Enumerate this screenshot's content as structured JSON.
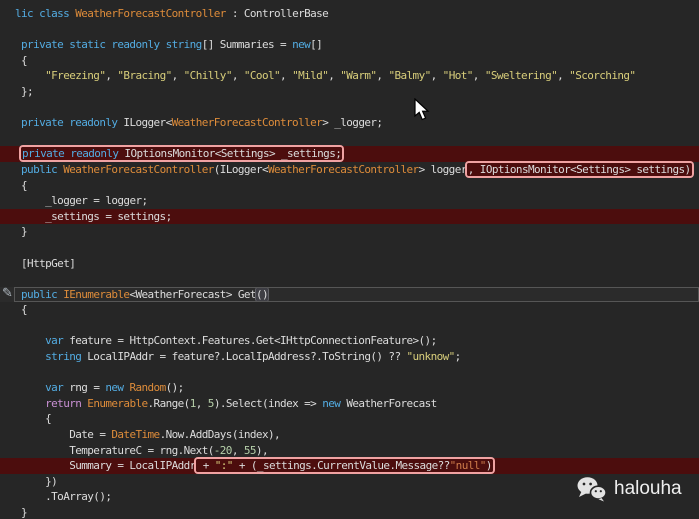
{
  "editor": {
    "language": "csharp",
    "colors": {
      "background": "#262626",
      "keyword": "#53ACE2",
      "type": "#DE8C3A",
      "string": "#D8CE7B",
      "number": "#B5CEA8",
      "control_keyword": "#C990D4",
      "string_alt": "#CE7B4A",
      "plain_text": "#DCDCDC",
      "changed_line_background": "#4C0D0D",
      "change_box_border": "#F0A2A2",
      "current_line_border": "#565656"
    },
    "lines": [
      {
        "indent": 0,
        "tokens": [
          [
            "lic class ",
            "k"
          ],
          [
            "WeatherForecastController",
            "t"
          ],
          [
            " : ",
            "p"
          ],
          [
            "ControllerBase",
            "p"
          ]
        ]
      },
      {
        "indent": 0,
        "tokens": []
      },
      {
        "indent": 1,
        "tokens": [
          [
            "private static readonly string",
            "k"
          ],
          [
            "[] Summaries = ",
            "p"
          ],
          [
            "new",
            "k"
          ],
          [
            "[]",
            "p"
          ]
        ]
      },
      {
        "indent": 1,
        "tokens": [
          [
            "{",
            "p"
          ]
        ]
      },
      {
        "indent": 5,
        "tokens": [
          [
            "\"Freezing\"",
            "s"
          ],
          [
            ", ",
            "p"
          ],
          [
            "\"Bracing\"",
            "s"
          ],
          [
            ", ",
            "p"
          ],
          [
            "\"Chilly\"",
            "s"
          ],
          [
            ", ",
            "p"
          ],
          [
            "\"Cool\"",
            "s"
          ],
          [
            ", ",
            "p"
          ],
          [
            "\"Mild\"",
            "s"
          ],
          [
            ", ",
            "p"
          ],
          [
            "\"Warm\"",
            "s"
          ],
          [
            ", ",
            "p"
          ],
          [
            "\"Balmy\"",
            "s"
          ],
          [
            ", ",
            "p"
          ],
          [
            "\"Hot\"",
            "s"
          ],
          [
            ", ",
            "p"
          ],
          [
            "\"Sweltering\"",
            "s"
          ],
          [
            ", ",
            "p"
          ],
          [
            "\"Scorching\"",
            "s"
          ]
        ]
      },
      {
        "indent": 1,
        "tokens": [
          [
            "};",
            "p"
          ]
        ]
      },
      {
        "indent": 0,
        "tokens": []
      },
      {
        "indent": 1,
        "tokens": [
          [
            "private readonly ",
            "k"
          ],
          [
            "ILogger<",
            "p"
          ],
          [
            "WeatherForecastController",
            "t"
          ],
          [
            "> _logger;",
            "p"
          ]
        ]
      },
      {
        "indent": 0,
        "tokens": []
      },
      {
        "indent": 1,
        "hl": "maroon",
        "tokens": [
          [
            "private readonly ",
            "k",
            true
          ],
          [
            "IOptionsMonitor<Settings> _settings;",
            "p",
            true
          ]
        ]
      },
      {
        "indent": 1,
        "tokens": [
          [
            "public ",
            "k"
          ],
          [
            "WeatherForecastController",
            "t"
          ],
          [
            "(ILogger<",
            "p"
          ],
          [
            "WeatherForecastController",
            "t"
          ],
          [
            "> logger",
            "p"
          ],
          [
            ", IOptionsMonitor<Settings> settings)",
            "p",
            true
          ]
        ]
      },
      {
        "indent": 1,
        "tokens": [
          [
            "{",
            "p"
          ]
        ]
      },
      {
        "indent": 5,
        "tokens": [
          [
            "_logger = logger;",
            "p"
          ]
        ]
      },
      {
        "indent": 5,
        "hl": "maroon",
        "tokens": [
          [
            "_settings = settings;",
            "p"
          ]
        ]
      },
      {
        "indent": 1,
        "tokens": [
          [
            "}",
            "p"
          ]
        ]
      },
      {
        "indent": 0,
        "tokens": []
      },
      {
        "indent": 1,
        "tokens": [
          [
            "[HttpGet]",
            "p"
          ]
        ]
      },
      {
        "indent": 0,
        "tokens": []
      },
      {
        "indent": 1,
        "hl": "current",
        "tokens": [
          [
            "public ",
            "k"
          ],
          [
            "IEnumerable",
            "t"
          ],
          [
            "<WeatherForecast> Get",
            "p"
          ],
          [
            "()",
            "x"
          ]
        ]
      },
      {
        "indent": 1,
        "tokens": [
          [
            "{",
            "p"
          ]
        ]
      },
      {
        "indent": 0,
        "tokens": []
      },
      {
        "indent": 5,
        "tokens": [
          [
            "var",
            "k"
          ],
          [
            " feature = HttpContext.Features.Get<IHttpConnectionFeature>();",
            "p"
          ]
        ]
      },
      {
        "indent": 5,
        "tokens": [
          [
            "string",
            "k"
          ],
          [
            " LocalIPAddr = feature?.LocalIpAddress?.ToString() ?? ",
            "p"
          ],
          [
            "\"unknow\"",
            "s"
          ],
          [
            ";",
            "p"
          ]
        ]
      },
      {
        "indent": 0,
        "tokens": []
      },
      {
        "indent": 5,
        "tokens": [
          [
            "var",
            "k"
          ],
          [
            " rng = ",
            "p"
          ],
          [
            "new ",
            "k"
          ],
          [
            "Random",
            "t"
          ],
          [
            "();",
            "p"
          ]
        ]
      },
      {
        "indent": 5,
        "tokens": [
          [
            "return ",
            "r"
          ],
          [
            "Enumerable",
            "t"
          ],
          [
            ".Range(",
            "p"
          ],
          [
            "1",
            "n"
          ],
          [
            ", ",
            "p"
          ],
          [
            "5",
            "n"
          ],
          [
            ").Select(index => ",
            "p"
          ],
          [
            "new ",
            "k"
          ],
          [
            "WeatherForecast",
            "p"
          ]
        ]
      },
      {
        "indent": 5,
        "tokens": [
          [
            "{",
            "p"
          ]
        ]
      },
      {
        "indent": 9,
        "tokens": [
          [
            "Date = ",
            "p"
          ],
          [
            "DateTime",
            "t"
          ],
          [
            ".Now.AddDays(index),",
            "p"
          ]
        ]
      },
      {
        "indent": 9,
        "tokens": [
          [
            "TemperatureC = rng.Next(",
            "p"
          ],
          [
            "-20",
            "n"
          ],
          [
            ", ",
            "p"
          ],
          [
            "55",
            "n"
          ],
          [
            "),",
            "p"
          ]
        ]
      },
      {
        "indent": 9,
        "hl": "maroon",
        "tokens": [
          [
            "Summary = LocalIPAddr",
            "p"
          ],
          [
            " + ",
            "p",
            true
          ],
          [
            "\":\"",
            "s",
            true
          ],
          [
            " + (_settings.CurrentValue.Message??",
            "p",
            true
          ],
          [
            "\"null\"",
            "sn",
            true
          ],
          [
            ")",
            "p",
            true
          ]
        ]
      },
      {
        "indent": 5,
        "tokens": [
          [
            "})",
            "p"
          ]
        ]
      },
      {
        "indent": 5,
        "tokens": [
          [
            ".ToArray();",
            "p"
          ]
        ]
      },
      {
        "indent": 1,
        "tokens": [
          [
            "}",
            "p"
          ]
        ]
      }
    ]
  },
  "gutter": {
    "quick_action_icon": "pen-icon",
    "quick_action_glyph": "✎"
  },
  "watermark": {
    "icon": "wechat-icon",
    "label": "halouha"
  },
  "cursor": {
    "visible": true,
    "shape": "arrow"
  }
}
